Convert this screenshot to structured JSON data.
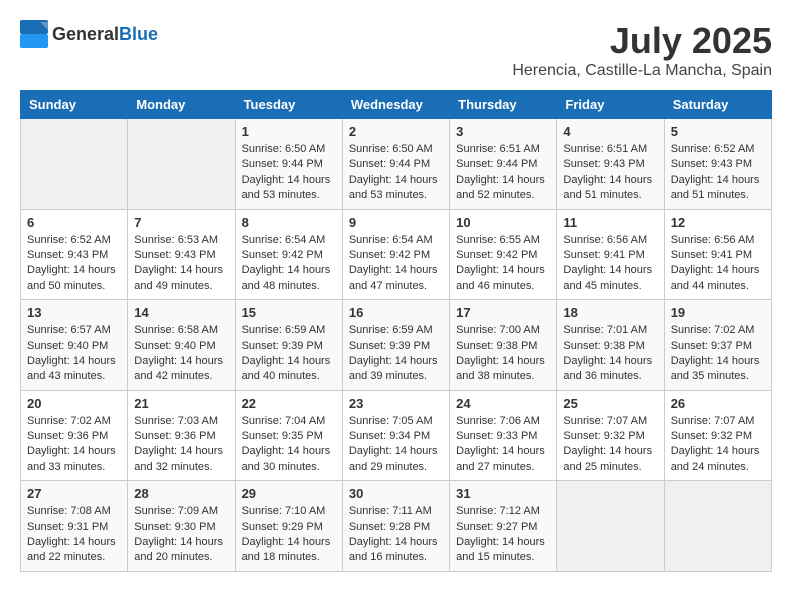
{
  "header": {
    "logo_general": "General",
    "logo_blue": "Blue",
    "month": "July 2025",
    "location": "Herencia, Castille-La Mancha, Spain"
  },
  "days_of_week": [
    "Sunday",
    "Monday",
    "Tuesday",
    "Wednesday",
    "Thursday",
    "Friday",
    "Saturday"
  ],
  "weeks": [
    [
      {
        "day": "",
        "sunrise": "",
        "sunset": "",
        "daylight": ""
      },
      {
        "day": "",
        "sunrise": "",
        "sunset": "",
        "daylight": ""
      },
      {
        "day": "1",
        "sunrise": "Sunrise: 6:50 AM",
        "sunset": "Sunset: 9:44 PM",
        "daylight": "Daylight: 14 hours and 53 minutes."
      },
      {
        "day": "2",
        "sunrise": "Sunrise: 6:50 AM",
        "sunset": "Sunset: 9:44 PM",
        "daylight": "Daylight: 14 hours and 53 minutes."
      },
      {
        "day": "3",
        "sunrise": "Sunrise: 6:51 AM",
        "sunset": "Sunset: 9:44 PM",
        "daylight": "Daylight: 14 hours and 52 minutes."
      },
      {
        "day": "4",
        "sunrise": "Sunrise: 6:51 AM",
        "sunset": "Sunset: 9:43 PM",
        "daylight": "Daylight: 14 hours and 51 minutes."
      },
      {
        "day": "5",
        "sunrise": "Sunrise: 6:52 AM",
        "sunset": "Sunset: 9:43 PM",
        "daylight": "Daylight: 14 hours and 51 minutes."
      }
    ],
    [
      {
        "day": "6",
        "sunrise": "Sunrise: 6:52 AM",
        "sunset": "Sunset: 9:43 PM",
        "daylight": "Daylight: 14 hours and 50 minutes."
      },
      {
        "day": "7",
        "sunrise": "Sunrise: 6:53 AM",
        "sunset": "Sunset: 9:43 PM",
        "daylight": "Daylight: 14 hours and 49 minutes."
      },
      {
        "day": "8",
        "sunrise": "Sunrise: 6:54 AM",
        "sunset": "Sunset: 9:42 PM",
        "daylight": "Daylight: 14 hours and 48 minutes."
      },
      {
        "day": "9",
        "sunrise": "Sunrise: 6:54 AM",
        "sunset": "Sunset: 9:42 PM",
        "daylight": "Daylight: 14 hours and 47 minutes."
      },
      {
        "day": "10",
        "sunrise": "Sunrise: 6:55 AM",
        "sunset": "Sunset: 9:42 PM",
        "daylight": "Daylight: 14 hours and 46 minutes."
      },
      {
        "day": "11",
        "sunrise": "Sunrise: 6:56 AM",
        "sunset": "Sunset: 9:41 PM",
        "daylight": "Daylight: 14 hours and 45 minutes."
      },
      {
        "day": "12",
        "sunrise": "Sunrise: 6:56 AM",
        "sunset": "Sunset: 9:41 PM",
        "daylight": "Daylight: 14 hours and 44 minutes."
      }
    ],
    [
      {
        "day": "13",
        "sunrise": "Sunrise: 6:57 AM",
        "sunset": "Sunset: 9:40 PM",
        "daylight": "Daylight: 14 hours and 43 minutes."
      },
      {
        "day": "14",
        "sunrise": "Sunrise: 6:58 AM",
        "sunset": "Sunset: 9:40 PM",
        "daylight": "Daylight: 14 hours and 42 minutes."
      },
      {
        "day": "15",
        "sunrise": "Sunrise: 6:59 AM",
        "sunset": "Sunset: 9:39 PM",
        "daylight": "Daylight: 14 hours and 40 minutes."
      },
      {
        "day": "16",
        "sunrise": "Sunrise: 6:59 AM",
        "sunset": "Sunset: 9:39 PM",
        "daylight": "Daylight: 14 hours and 39 minutes."
      },
      {
        "day": "17",
        "sunrise": "Sunrise: 7:00 AM",
        "sunset": "Sunset: 9:38 PM",
        "daylight": "Daylight: 14 hours and 38 minutes."
      },
      {
        "day": "18",
        "sunrise": "Sunrise: 7:01 AM",
        "sunset": "Sunset: 9:38 PM",
        "daylight": "Daylight: 14 hours and 36 minutes."
      },
      {
        "day": "19",
        "sunrise": "Sunrise: 7:02 AM",
        "sunset": "Sunset: 9:37 PM",
        "daylight": "Daylight: 14 hours and 35 minutes."
      }
    ],
    [
      {
        "day": "20",
        "sunrise": "Sunrise: 7:02 AM",
        "sunset": "Sunset: 9:36 PM",
        "daylight": "Daylight: 14 hours and 33 minutes."
      },
      {
        "day": "21",
        "sunrise": "Sunrise: 7:03 AM",
        "sunset": "Sunset: 9:36 PM",
        "daylight": "Daylight: 14 hours and 32 minutes."
      },
      {
        "day": "22",
        "sunrise": "Sunrise: 7:04 AM",
        "sunset": "Sunset: 9:35 PM",
        "daylight": "Daylight: 14 hours and 30 minutes."
      },
      {
        "day": "23",
        "sunrise": "Sunrise: 7:05 AM",
        "sunset": "Sunset: 9:34 PM",
        "daylight": "Daylight: 14 hours and 29 minutes."
      },
      {
        "day": "24",
        "sunrise": "Sunrise: 7:06 AM",
        "sunset": "Sunset: 9:33 PM",
        "daylight": "Daylight: 14 hours and 27 minutes."
      },
      {
        "day": "25",
        "sunrise": "Sunrise: 7:07 AM",
        "sunset": "Sunset: 9:32 PM",
        "daylight": "Daylight: 14 hours and 25 minutes."
      },
      {
        "day": "26",
        "sunrise": "Sunrise: 7:07 AM",
        "sunset": "Sunset: 9:32 PM",
        "daylight": "Daylight: 14 hours and 24 minutes."
      }
    ],
    [
      {
        "day": "27",
        "sunrise": "Sunrise: 7:08 AM",
        "sunset": "Sunset: 9:31 PM",
        "daylight": "Daylight: 14 hours and 22 minutes."
      },
      {
        "day": "28",
        "sunrise": "Sunrise: 7:09 AM",
        "sunset": "Sunset: 9:30 PM",
        "daylight": "Daylight: 14 hours and 20 minutes."
      },
      {
        "day": "29",
        "sunrise": "Sunrise: 7:10 AM",
        "sunset": "Sunset: 9:29 PM",
        "daylight": "Daylight: 14 hours and 18 minutes."
      },
      {
        "day": "30",
        "sunrise": "Sunrise: 7:11 AM",
        "sunset": "Sunset: 9:28 PM",
        "daylight": "Daylight: 14 hours and 16 minutes."
      },
      {
        "day": "31",
        "sunrise": "Sunrise: 7:12 AM",
        "sunset": "Sunset: 9:27 PM",
        "daylight": "Daylight: 14 hours and 15 minutes."
      },
      {
        "day": "",
        "sunrise": "",
        "sunset": "",
        "daylight": ""
      },
      {
        "day": "",
        "sunrise": "",
        "sunset": "",
        "daylight": ""
      }
    ]
  ]
}
